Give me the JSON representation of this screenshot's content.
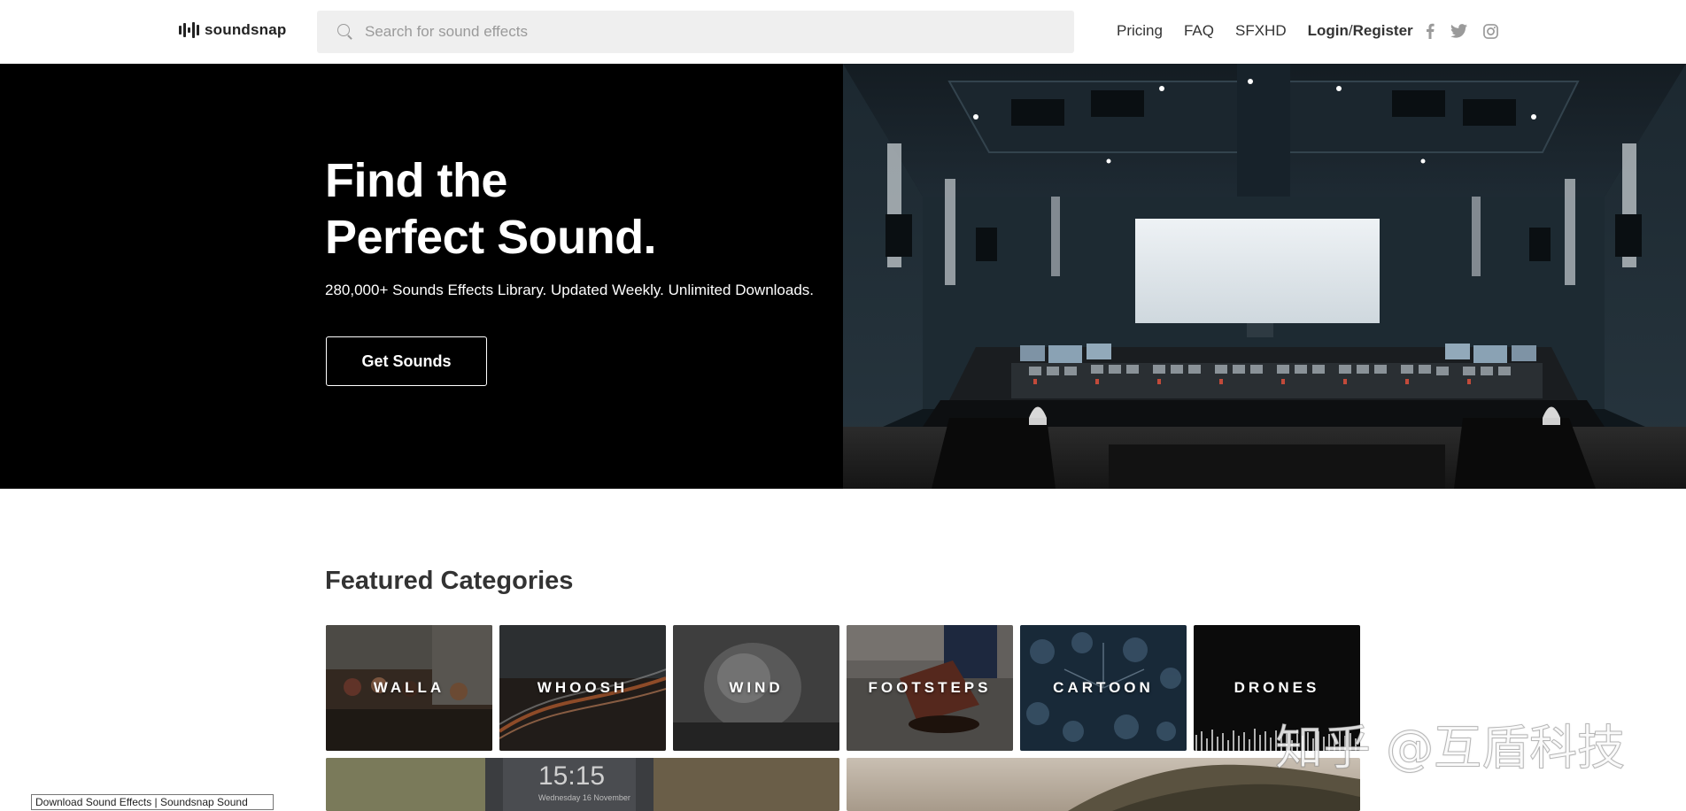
{
  "header": {
    "logo_text": "soundsnap",
    "search_placeholder": "Search for sound effects",
    "nav": {
      "pricing": "Pricing",
      "faq": "FAQ",
      "sfxhd": "SFXHD",
      "login": "Login",
      "slash": "/",
      "register": "Register"
    },
    "social_icons": [
      "facebook-icon",
      "twitter-icon",
      "instagram-icon"
    ]
  },
  "hero": {
    "title_line1": "Find the",
    "title_line2": "Perfect Sound.",
    "subtitle": "280,000+ Sounds Effects Library. Updated Weekly. Unlimited Downloads.",
    "button": "Get Sounds"
  },
  "featured": {
    "title": "Featured Categories",
    "categories": [
      {
        "label": "WALLA",
        "color": "#4a3a2e"
      },
      {
        "label": "WHOOSH",
        "color": "#2c2622"
      },
      {
        "label": "WIND",
        "color": "#5a5a5a"
      },
      {
        "label": "FOOTSTEPS",
        "color": "#6e6a66"
      },
      {
        "label": "CARTOON",
        "color": "#1f3446"
      },
      {
        "label": "DRONES",
        "color": "#0b0b0b"
      }
    ],
    "row2_time": "15:15",
    "row2_date": "Wednesday 16 November"
  },
  "watermark": "知乎 @互盾科技",
  "tooltip": "Download Sound Effects | Soundsnap Sound"
}
